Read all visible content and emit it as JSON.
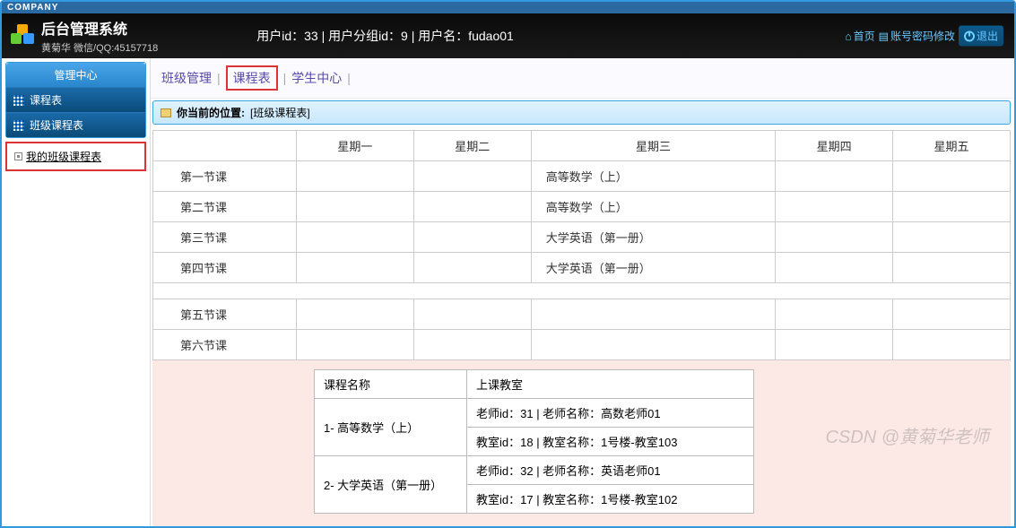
{
  "companyTag": "COMPANY",
  "header": {
    "title": "后台管理系统",
    "subtitle": "黄菊华 微信/QQ:45157718",
    "userInfo": "用户id：33 | 用户分组id：9 | 用户名：fudao01",
    "homeLabel": "首页",
    "pwdLabel": "账号密码修改",
    "logoutLabel": "退出"
  },
  "sidebar": {
    "centerTitle": "管理中心",
    "row1": "课程表",
    "row2": "班级课程表",
    "treeItem": "我的班级课程表"
  },
  "tabs": {
    "t1": "班级管理",
    "t2": "课程表",
    "t3": "学生中心",
    "sep": "|"
  },
  "breadcrumb": {
    "prefix": "你当前的位置:",
    "loc": "[班级课程表]"
  },
  "schedule": {
    "cornerBlank": "",
    "days": [
      "星期一",
      "星期二",
      "星期三",
      "星期四",
      "星期五"
    ],
    "rows": [
      {
        "period": "第一节课",
        "cells": [
          "",
          "",
          "高等数学（上）",
          "",
          ""
        ]
      },
      {
        "period": "第二节课",
        "cells": [
          "",
          "",
          "高等数学（上）",
          "",
          ""
        ]
      },
      {
        "period": "第三节课",
        "cells": [
          "",
          "",
          "大学英语（第一册）",
          "",
          ""
        ]
      },
      {
        "period": "第四节课",
        "cells": [
          "",
          "",
          "大学英语（第一册）",
          "",
          ""
        ]
      }
    ],
    "rows2": [
      {
        "period": "第五节课",
        "cells": [
          "",
          "",
          "",
          "",
          ""
        ]
      },
      {
        "period": "第六节课",
        "cells": [
          "",
          "",
          "",
          "",
          ""
        ]
      }
    ]
  },
  "details": {
    "h1": "课程名称",
    "h2": "上课教室",
    "items": [
      {
        "name": "1- 高等数学（上）",
        "line1": "老师id：31 | 老师名称：高数老师01",
        "line2": "教室id：18 | 教室名称：1号楼-教室103"
      },
      {
        "name": "2- 大学英语（第一册）",
        "line1": "老师id：32 | 老师名称：英语老师01",
        "line2": "教室id：17 | 教室名称：1号楼-教室102"
      }
    ]
  },
  "watermark": "CSDN @黄菊华老师"
}
